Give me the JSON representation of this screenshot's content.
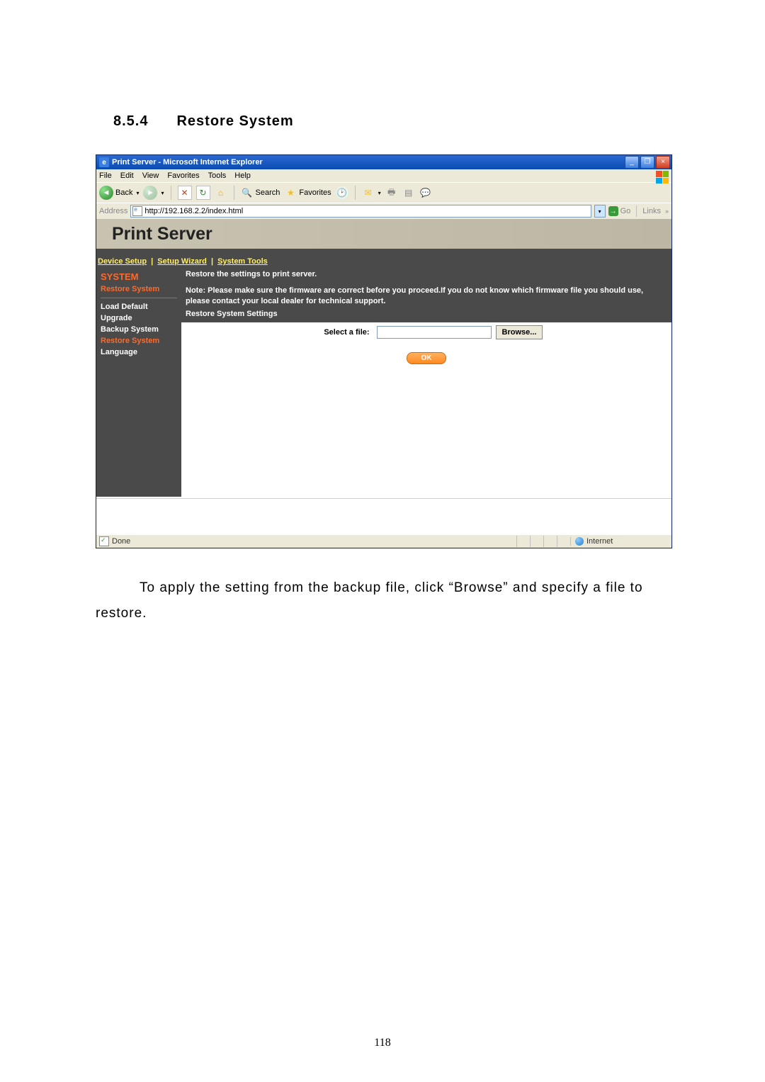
{
  "heading": {
    "number": "8.5.4",
    "title": "Restore System"
  },
  "window": {
    "title": "Print Server - Microsoft Internet Explorer",
    "menus": {
      "file": "File",
      "edit": "Edit",
      "view": "View",
      "favorites": "Favorites",
      "tools": "Tools",
      "help": "Help"
    },
    "toolbar": {
      "back": "Back",
      "search": "Search",
      "favorites": "Favorites"
    },
    "addressbar": {
      "label": "Address",
      "url": "http://192.168.2.2/index.html",
      "go": "Go",
      "links": "Links"
    },
    "statusbar": {
      "done": "Done",
      "zone": "Internet"
    }
  },
  "page": {
    "header_title": "Print Server",
    "tabs": {
      "device_setup": "Device Setup",
      "setup_wizard": "Setup Wizard",
      "system_tools": "System Tools"
    },
    "sidebar": {
      "title": "SYSTEM",
      "restore_system_top": "Restore System",
      "load_default": "Load Default",
      "upgrade": "Upgrade",
      "backup_system": "Backup System",
      "restore_system": "Restore System",
      "language": "Language"
    },
    "main": {
      "title": "Restore the settings to print server.",
      "note": "Note: Please make sure the firmware are correct before you proceed.If you do not know which firmware file you should use, please contact your local dealer for technical support.",
      "settings_header": "Restore System Settings",
      "select_label": "Select a file:",
      "browse": "Browse...",
      "ok": "OK"
    }
  },
  "body_text": "To apply the setting from the backup file, click “Browse” and specify a file to restore.",
  "page_number": "118"
}
